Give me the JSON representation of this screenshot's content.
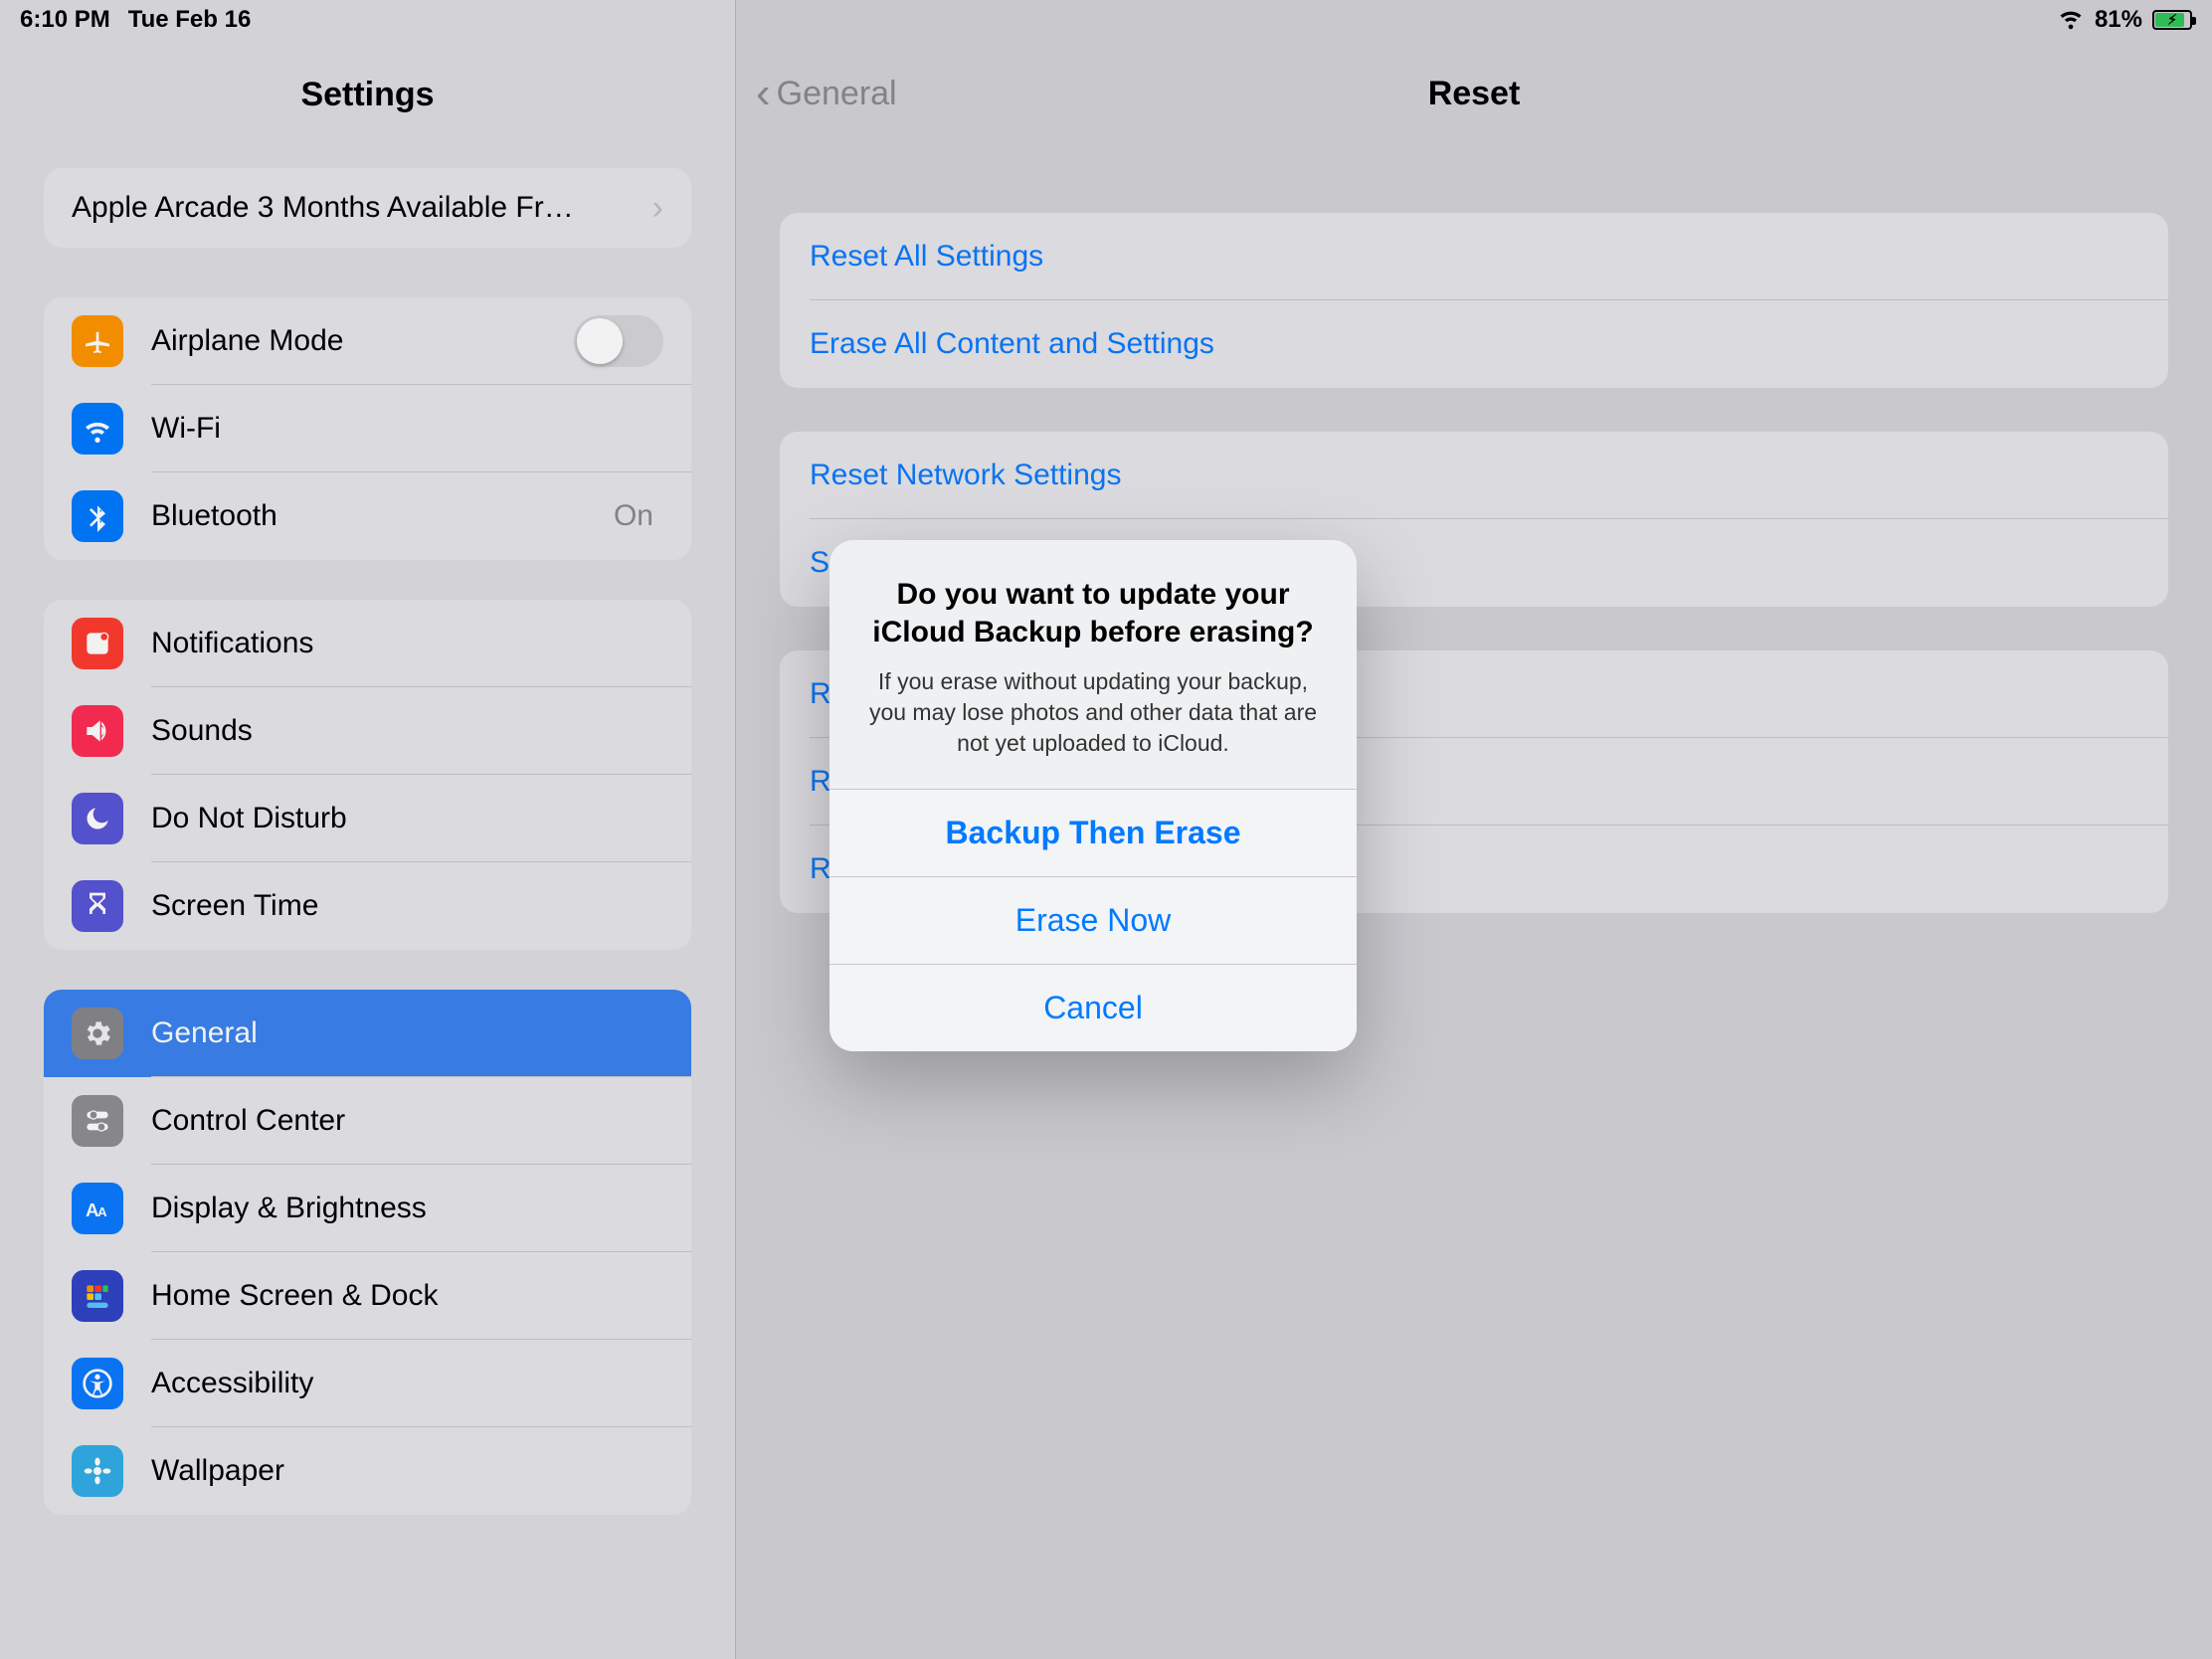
{
  "status": {
    "time": "6:10 PM",
    "date": "Tue Feb 16",
    "battery_pct": "81%"
  },
  "sidebar": {
    "title": "Settings",
    "promo": "Apple Arcade 3 Months Available Fr…",
    "items": {
      "airplane": "Airplane Mode",
      "wifi": "Wi-Fi",
      "bluetooth": "Bluetooth",
      "bluetooth_value": "On",
      "notifications": "Notifications",
      "sounds": "Sounds",
      "dnd": "Do Not Disturb",
      "screentime": "Screen Time",
      "general": "General",
      "controlcenter": "Control Center",
      "display": "Display & Brightness",
      "homescreen": "Home Screen & Dock",
      "accessibility": "Accessibility",
      "wallpaper": "Wallpaper"
    }
  },
  "detail": {
    "back": "General",
    "title": "Reset",
    "group1": {
      "reset_all": "Reset All Settings",
      "erase_all": "Erase All Content and Settings"
    },
    "group2": {
      "network": "Reset Network Settings",
      "subscriber": "S"
    },
    "group3": {
      "keyboard": "R",
      "homelayout": "R",
      "location": "R"
    }
  },
  "alert": {
    "title": "Do you want to update your iCloud Backup before erasing?",
    "message": "If you erase without updating your backup, you may lose photos and other data that are not yet uploaded to iCloud.",
    "backup": "Backup Then Erase",
    "erase": "Erase Now",
    "cancel": "Cancel"
  },
  "colors": {
    "orange": "#ff9500",
    "blue": "#007aff",
    "red": "#ff3b30",
    "pink": "#ff2d55",
    "indigo": "#5856d6",
    "gray": "#8e8e93",
    "teal": "#32ade6",
    "appblue": "#0a7aff"
  }
}
